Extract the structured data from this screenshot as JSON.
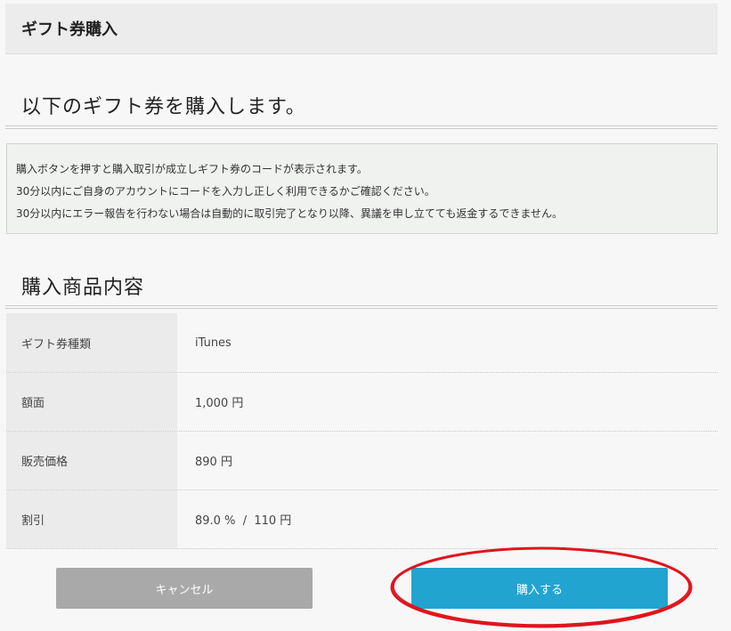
{
  "header": {
    "title": "ギフト券購入"
  },
  "intro": {
    "title": "以下のギフト券を購入します。"
  },
  "notice": {
    "lines": [
      "購入ボタンを押すと購入取引が成立しギフト券のコードが表示されます。",
      "30分以内にご自身のアカウントにコードを入力し正しく利用できるかご確認ください。",
      "30分以内にエラー報告を行わない場合は自動的に取引完了となり以降、異議を申し立てても返金するできません。"
    ]
  },
  "details": {
    "title": "購入商品内容",
    "rows": [
      {
        "label": "ギフト券種類",
        "value": "iTunes"
      },
      {
        "label": "額面",
        "value": "1,000 円"
      },
      {
        "label": "販売価格",
        "value": "890 円"
      },
      {
        "label": "割引",
        "value": "89.0 %  /  110 円"
      }
    ]
  },
  "buttons": {
    "cancel_label": "キャンセル",
    "buy_label": "購入する"
  },
  "colors": {
    "buy_button": "#22a4d0",
    "cancel_button": "#a9a9a9",
    "annotation": "#e0141e"
  }
}
